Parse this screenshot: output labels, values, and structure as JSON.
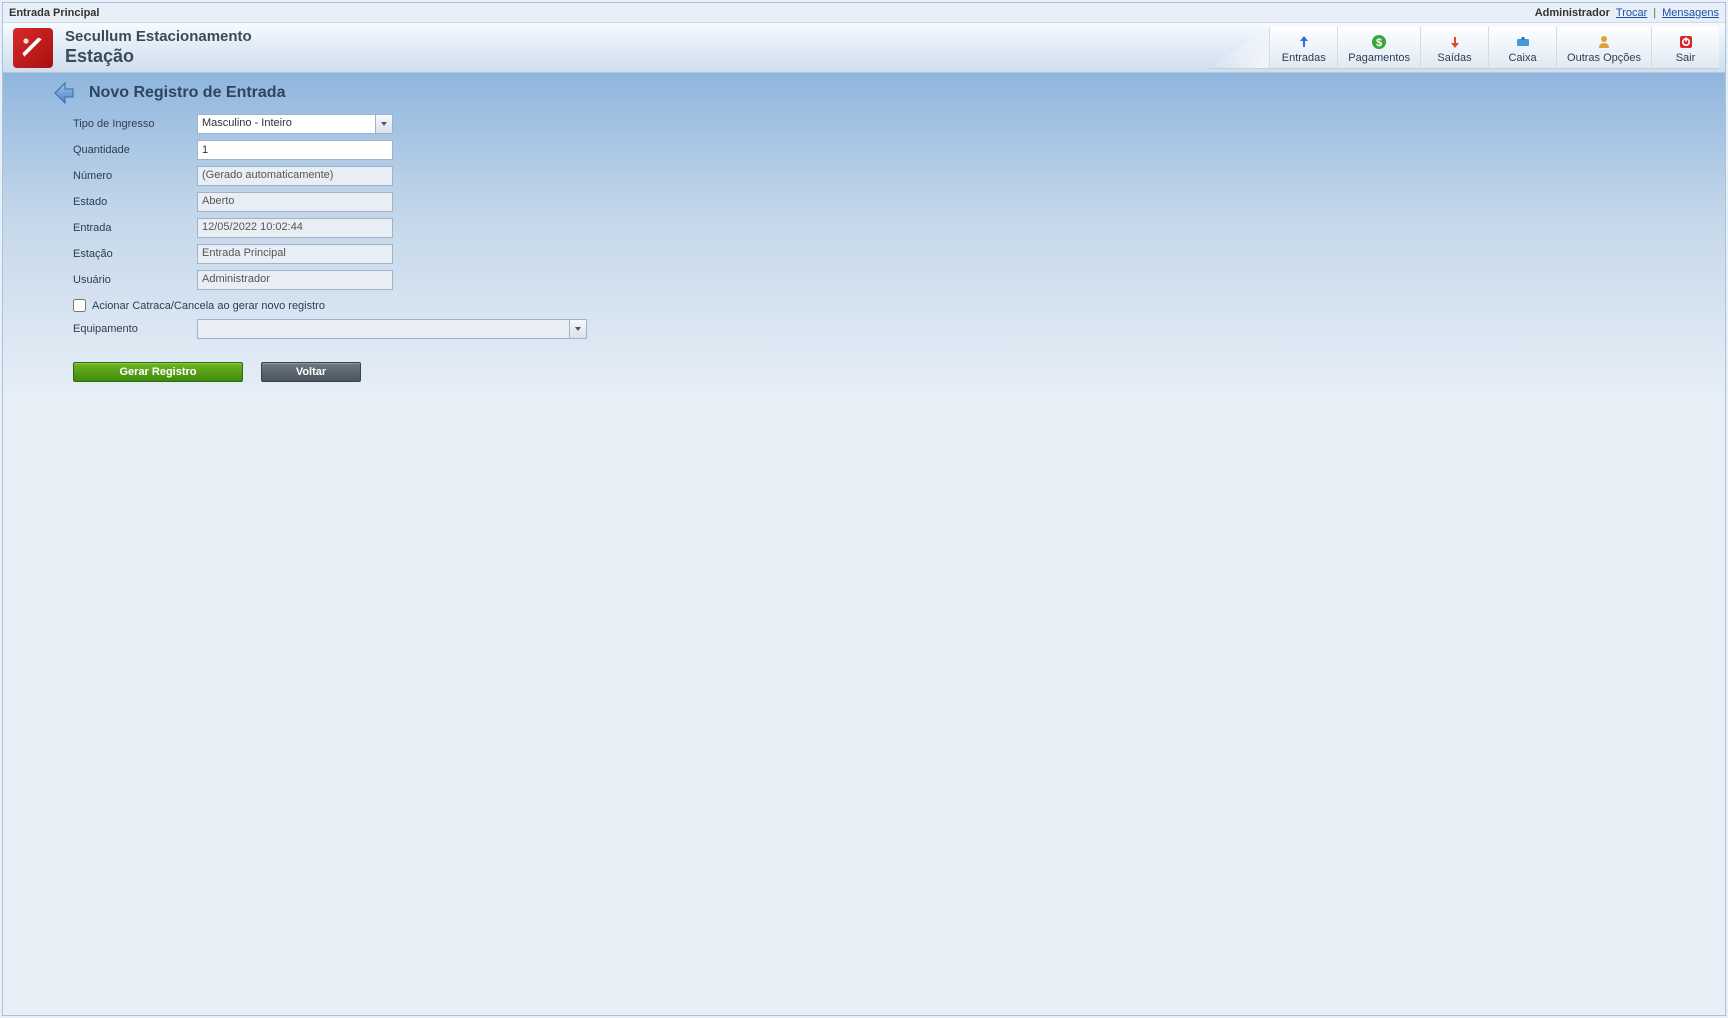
{
  "topbar": {
    "station": "Entrada Principal",
    "user": "Administrador",
    "change_link": "Trocar",
    "separator": "|",
    "messages_link": "Mensagens"
  },
  "header": {
    "app_line1": "Secullum Estacionamento",
    "app_line2": "Estação",
    "nav": [
      {
        "id": "entradas",
        "label": "Entradas",
        "icon": "arrow-in-icon",
        "color": "#2f6bd1"
      },
      {
        "id": "pagamentos",
        "label": "Pagamentos",
        "icon": "dollar-icon",
        "color": "#3aa53a"
      },
      {
        "id": "saidas",
        "label": "Saídas",
        "icon": "arrow-out-icon",
        "color": "#d84b2f"
      },
      {
        "id": "caixa",
        "label": "Caixa",
        "icon": "cash-icon",
        "color": "#4598d8"
      },
      {
        "id": "outras",
        "label": "Outras Opções",
        "icon": "person-icon",
        "color": "#e1a23c"
      },
      {
        "id": "sair",
        "label": "Sair",
        "icon": "power-icon",
        "color": "#d62a2a"
      }
    ]
  },
  "page": {
    "title": "Novo Registro de Entrada"
  },
  "form": {
    "tipo_ingresso": {
      "label": "Tipo de Ingresso",
      "value": "Masculino - Inteiro"
    },
    "quantidade": {
      "label": "Quantidade",
      "value": "1"
    },
    "numero": {
      "label": "Número",
      "value": "(Gerado automaticamente)"
    },
    "estado": {
      "label": "Estado",
      "value": "Aberto"
    },
    "entrada": {
      "label": "Entrada",
      "value": "12/05/2022 10:02:44"
    },
    "estacao": {
      "label": "Estação",
      "value": "Entrada Principal"
    },
    "usuario": {
      "label": "Usuário",
      "value": "Administrador"
    },
    "acionar_checkbox": {
      "label": "Acionar Catraca/Cancela ao gerar novo registro",
      "checked": false
    },
    "equipamento": {
      "label": "Equipamento",
      "value": ""
    }
  },
  "buttons": {
    "gerar": "Gerar Registro",
    "voltar": "Voltar"
  }
}
